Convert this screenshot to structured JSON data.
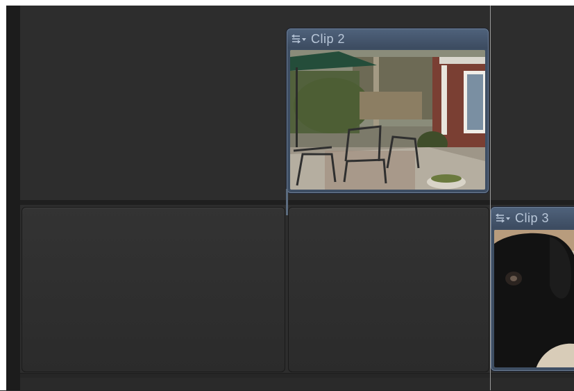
{
  "timeline": {
    "clips": [
      {
        "title": "Clip 2",
        "icon": "clip-options-icon",
        "thumbnail": "patio-with-umbrella-and-chairs"
      },
      {
        "title": "Clip 3",
        "icon": "clip-options-icon",
        "thumbnail": "black-dog-closeup"
      }
    ]
  },
  "colors": {
    "background": "#2c2c2c",
    "clip_header": "#4f627b",
    "clip_border": "#6e7f96",
    "clip_title": "#b9c7d9",
    "playhead": "#9a9a9a"
  }
}
